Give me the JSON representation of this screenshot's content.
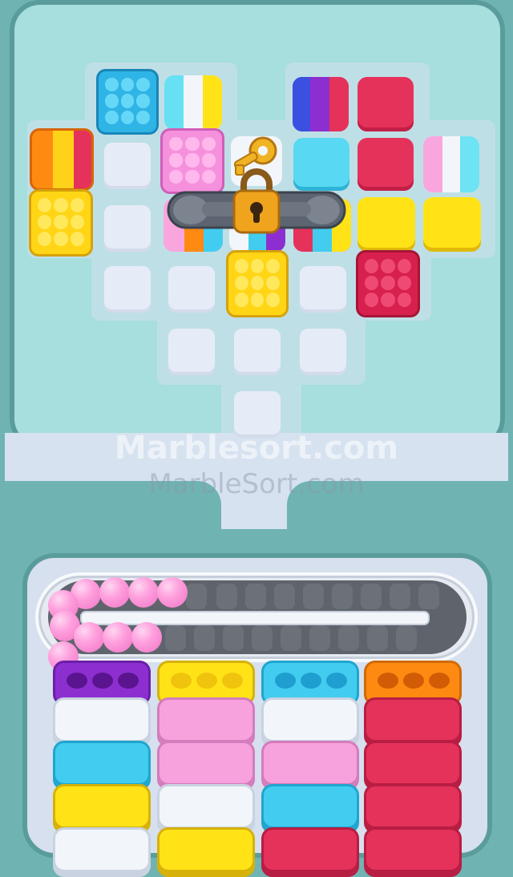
{
  "watermarks": {
    "primary": "Marblesort.com",
    "secondary": "MarbleSort.com"
  },
  "colors": {
    "background": "#6fb3b3",
    "board": "#a3dcdc",
    "board_edge": "#5a9c9c",
    "empty_cell": "#e6ecf7",
    "cyan": "#42cdf0",
    "white": "#f2f6fb",
    "yellow": "#ffe317",
    "pink": "#f7a2dd",
    "red": "#e5325a",
    "purple": "#8d2fd0",
    "orange": "#ff8a12",
    "blue": "#3b4fe0",
    "marble": "#ff9fdd",
    "lock_gold": "#f0a41e",
    "chain": "#5b6470"
  },
  "icons": {
    "lock": "padlock-icon",
    "key": "key-icon",
    "chain": "chain-link-icon",
    "marble": "marble-icon"
  },
  "conveyor": {
    "marbles_loaded": 10,
    "slots_empty": 17
  },
  "collector_columns": [
    {
      "lid": "purple",
      "stack": [
        "white",
        "cyan",
        "yellow",
        "white"
      ]
    },
    {
      "lid": "yellow",
      "stack": [
        "pink",
        "pink",
        "white",
        "yellow"
      ]
    },
    {
      "lid": "cyan",
      "stack": [
        "white",
        "pink",
        "cyan",
        "red"
      ]
    },
    {
      "lid": "orange",
      "stack": [
        "red",
        "red",
        "red",
        "red"
      ]
    }
  ]
}
